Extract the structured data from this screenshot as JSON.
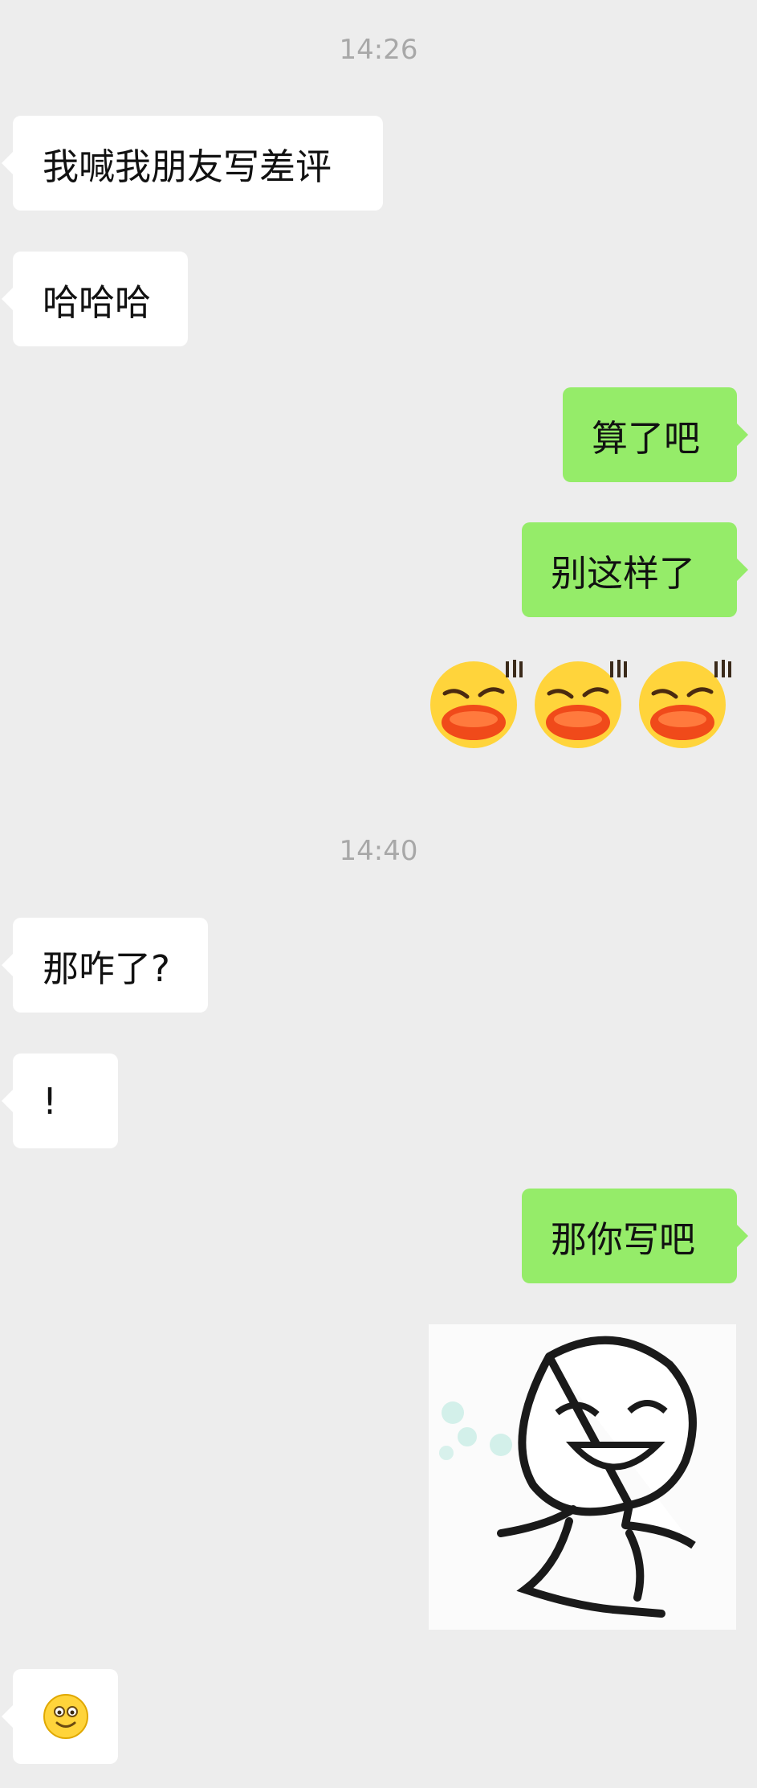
{
  "chat": {
    "timestamps": [
      "14:26",
      "14:40"
    ],
    "messages": [
      {
        "side": "left",
        "text": "我喊我朋友写差评"
      },
      {
        "side": "left",
        "text": "哈哈哈"
      },
      {
        "side": "right",
        "text": "算了吧"
      },
      {
        "side": "right",
        "text": "别这样了"
      },
      {
        "side": "right",
        "icon": "smirk-duck-lips-emoji x3"
      },
      {
        "side": "left",
        "text": "那咋了?"
      },
      {
        "side": "left",
        "text": "!"
      },
      {
        "side": "right",
        "text": "那你写吧"
      },
      {
        "side": "right",
        "icon": "laughing-doodle-sticker"
      },
      {
        "side": "left",
        "icon": "smile-emoji"
      }
    ]
  },
  "colors": {
    "background": "#ededed",
    "incoming_bubble": "#ffffff",
    "outgoing_bubble": "#95ec69",
    "timestamp_text": "#a8a8a8"
  }
}
